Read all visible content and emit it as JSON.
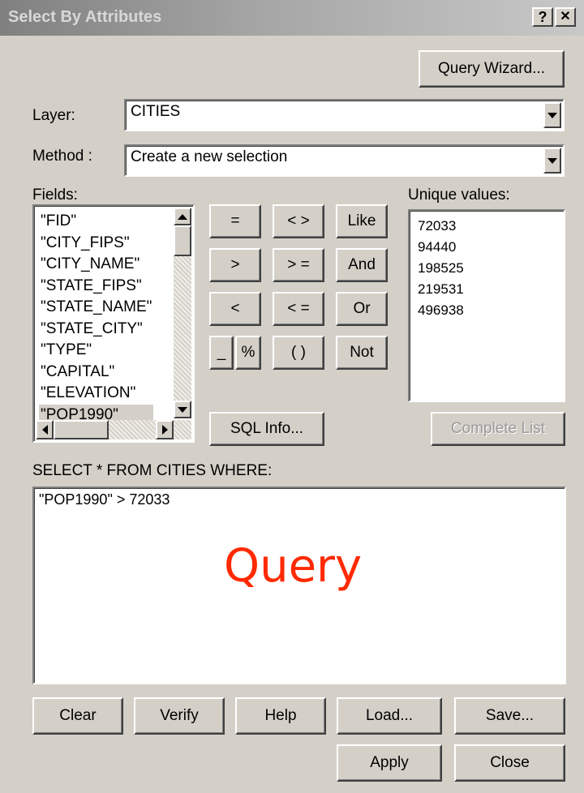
{
  "window": {
    "title": "Select By Attributes",
    "help_glyph": "?",
    "close_glyph": "✕"
  },
  "buttons": {
    "query_wizard": "Query Wizard...",
    "sql_info": "SQL Info...",
    "complete_list": "Complete List",
    "clear": "Clear",
    "verify": "Verify",
    "help": "Help",
    "load": "Load...",
    "save": "Save...",
    "apply": "Apply",
    "close": "Close"
  },
  "layer": {
    "label": "Layer:",
    "value": "CITIES"
  },
  "method": {
    "label": "Method :",
    "value": "Create a new selection"
  },
  "fields": {
    "label": "Fields:",
    "items": [
      "\"FID\"",
      "\"CITY_FIPS\"",
      "\"CITY_NAME\"",
      "\"STATE_FIPS\"",
      "\"STATE_NAME\"",
      "\"STATE_CITY\"",
      "\"TYPE\"",
      "\"CAPITAL\"",
      "\"ELEVATION\"",
      "\"POP1990\""
    ],
    "selected": "\"POP1990\""
  },
  "operators": {
    "equals": "=",
    "not_equal": "< >",
    "like": "Like",
    "greater": ">",
    "greater_equal": "> =",
    "and": "And",
    "less": "<",
    "less_equal": "< =",
    "or": "Or",
    "underscore": "_",
    "percent": "%",
    "parens": "( )",
    "not": "Not"
  },
  "unique_values": {
    "label": "Unique values:",
    "items": [
      "72033",
      "94440",
      "198525",
      "219531",
      "496938"
    ]
  },
  "query": {
    "label": "SELECT * FROM CITIES WHERE:",
    "expression": "\"POP1990\" > 72033"
  },
  "overlay": {
    "text": "Query",
    "color": "#ff2a00"
  },
  "colors": {
    "dialog_bg": "#d4d0c8",
    "field_bg": "#ffffff"
  }
}
